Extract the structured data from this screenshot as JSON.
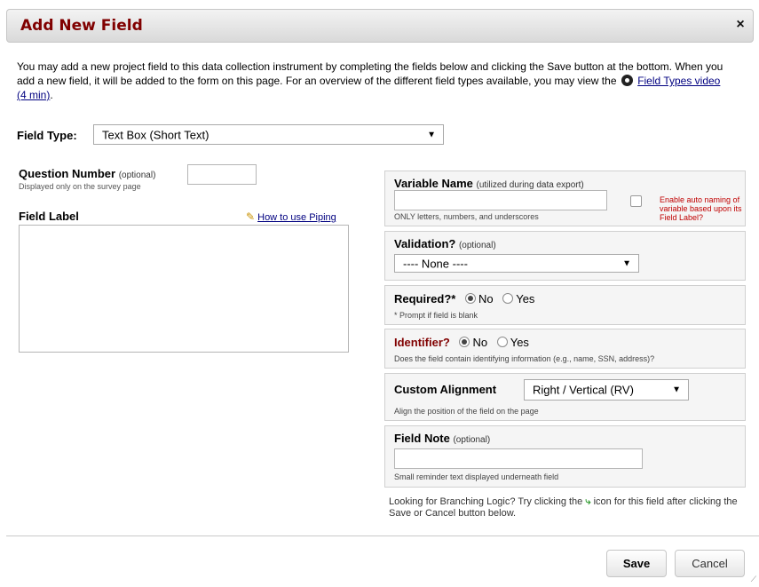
{
  "dialog": {
    "title": "Add New Field",
    "close_glyph": "×"
  },
  "intro": {
    "text": "You may add a new project field to this data collection instrument by completing the fields below and clicking the Save button at the bottom. When you add a new field, it will be added to the form on this page. For an overview of the different field types available, you may view the",
    "video_link": "Field Types video (4 min)",
    "trailing": ".",
    "icon": "film-reel-icon"
  },
  "field_type": {
    "label": "Field Type:",
    "value": "Text Box (Short Text)"
  },
  "question_number": {
    "label": "Question Number",
    "optional": "(optional)",
    "sub": "Displayed only on the survey page",
    "value": ""
  },
  "field_label": {
    "label": "Field Label",
    "piping_link": "How to use Piping",
    "value": ""
  },
  "variable_name": {
    "label": "Variable Name",
    "hint": "(utilized during data export)",
    "sub": "ONLY letters, numbers, and underscores",
    "value": "",
    "auto_naming": "Enable auto naming of variable based upon its Field Label?"
  },
  "validation": {
    "label": "Validation?",
    "optional": "(optional)",
    "value": "---- None ----"
  },
  "required": {
    "label": "Required?*",
    "no": "No",
    "yes": "Yes",
    "selected": "No",
    "sub": "* Prompt if field is blank"
  },
  "identifier": {
    "label": "Identifier?",
    "no": "No",
    "yes": "Yes",
    "selected": "No",
    "sub": "Does the field contain identifying information (e.g., name, SSN, address)?",
    "label_color": "#800000"
  },
  "custom_alignment": {
    "label": "Custom Alignment",
    "value": "Right / Vertical (RV)",
    "sub": "Align the position of the field on the page"
  },
  "field_note": {
    "label": "Field Note",
    "optional": "(optional)",
    "sub": "Small reminder text displayed underneath field",
    "value": ""
  },
  "branching": {
    "text_before": "Looking for Branching Logic? Try clicking the",
    "text_after": "icon for this field after clicking the Save or Cancel button below.",
    "icon": "branching-logic-icon"
  },
  "footer": {
    "save": "Save",
    "cancel": "Cancel"
  }
}
